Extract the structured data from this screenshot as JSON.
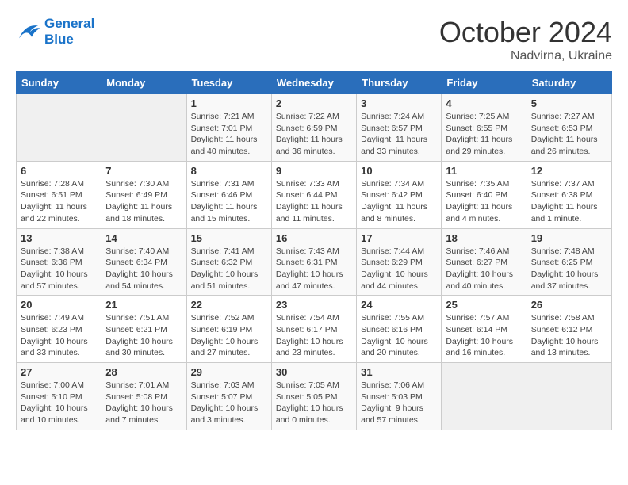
{
  "header": {
    "logo_line1": "General",
    "logo_line2": "Blue",
    "month": "October 2024",
    "location": "Nadvirna, Ukraine"
  },
  "weekdays": [
    "Sunday",
    "Monday",
    "Tuesday",
    "Wednesday",
    "Thursday",
    "Friday",
    "Saturday"
  ],
  "weeks": [
    [
      {
        "day": "",
        "info": ""
      },
      {
        "day": "",
        "info": ""
      },
      {
        "day": "1",
        "info": "Sunrise: 7:21 AM\nSunset: 7:01 PM\nDaylight: 11 hours and 40 minutes."
      },
      {
        "day": "2",
        "info": "Sunrise: 7:22 AM\nSunset: 6:59 PM\nDaylight: 11 hours and 36 minutes."
      },
      {
        "day": "3",
        "info": "Sunrise: 7:24 AM\nSunset: 6:57 PM\nDaylight: 11 hours and 33 minutes."
      },
      {
        "day": "4",
        "info": "Sunrise: 7:25 AM\nSunset: 6:55 PM\nDaylight: 11 hours and 29 minutes."
      },
      {
        "day": "5",
        "info": "Sunrise: 7:27 AM\nSunset: 6:53 PM\nDaylight: 11 hours and 26 minutes."
      }
    ],
    [
      {
        "day": "6",
        "info": "Sunrise: 7:28 AM\nSunset: 6:51 PM\nDaylight: 11 hours and 22 minutes."
      },
      {
        "day": "7",
        "info": "Sunrise: 7:30 AM\nSunset: 6:49 PM\nDaylight: 11 hours and 18 minutes."
      },
      {
        "day": "8",
        "info": "Sunrise: 7:31 AM\nSunset: 6:46 PM\nDaylight: 11 hours and 15 minutes."
      },
      {
        "day": "9",
        "info": "Sunrise: 7:33 AM\nSunset: 6:44 PM\nDaylight: 11 hours and 11 minutes."
      },
      {
        "day": "10",
        "info": "Sunrise: 7:34 AM\nSunset: 6:42 PM\nDaylight: 11 hours and 8 minutes."
      },
      {
        "day": "11",
        "info": "Sunrise: 7:35 AM\nSunset: 6:40 PM\nDaylight: 11 hours and 4 minutes."
      },
      {
        "day": "12",
        "info": "Sunrise: 7:37 AM\nSunset: 6:38 PM\nDaylight: 11 hours and 1 minute."
      }
    ],
    [
      {
        "day": "13",
        "info": "Sunrise: 7:38 AM\nSunset: 6:36 PM\nDaylight: 10 hours and 57 minutes."
      },
      {
        "day": "14",
        "info": "Sunrise: 7:40 AM\nSunset: 6:34 PM\nDaylight: 10 hours and 54 minutes."
      },
      {
        "day": "15",
        "info": "Sunrise: 7:41 AM\nSunset: 6:32 PM\nDaylight: 10 hours and 51 minutes."
      },
      {
        "day": "16",
        "info": "Sunrise: 7:43 AM\nSunset: 6:31 PM\nDaylight: 10 hours and 47 minutes."
      },
      {
        "day": "17",
        "info": "Sunrise: 7:44 AM\nSunset: 6:29 PM\nDaylight: 10 hours and 44 minutes."
      },
      {
        "day": "18",
        "info": "Sunrise: 7:46 AM\nSunset: 6:27 PM\nDaylight: 10 hours and 40 minutes."
      },
      {
        "day": "19",
        "info": "Sunrise: 7:48 AM\nSunset: 6:25 PM\nDaylight: 10 hours and 37 minutes."
      }
    ],
    [
      {
        "day": "20",
        "info": "Sunrise: 7:49 AM\nSunset: 6:23 PM\nDaylight: 10 hours and 33 minutes."
      },
      {
        "day": "21",
        "info": "Sunrise: 7:51 AM\nSunset: 6:21 PM\nDaylight: 10 hours and 30 minutes."
      },
      {
        "day": "22",
        "info": "Sunrise: 7:52 AM\nSunset: 6:19 PM\nDaylight: 10 hours and 27 minutes."
      },
      {
        "day": "23",
        "info": "Sunrise: 7:54 AM\nSunset: 6:17 PM\nDaylight: 10 hours and 23 minutes."
      },
      {
        "day": "24",
        "info": "Sunrise: 7:55 AM\nSunset: 6:16 PM\nDaylight: 10 hours and 20 minutes."
      },
      {
        "day": "25",
        "info": "Sunrise: 7:57 AM\nSunset: 6:14 PM\nDaylight: 10 hours and 16 minutes."
      },
      {
        "day": "26",
        "info": "Sunrise: 7:58 AM\nSunset: 6:12 PM\nDaylight: 10 hours and 13 minutes."
      }
    ],
    [
      {
        "day": "27",
        "info": "Sunrise: 7:00 AM\nSunset: 5:10 PM\nDaylight: 10 hours and 10 minutes."
      },
      {
        "day": "28",
        "info": "Sunrise: 7:01 AM\nSunset: 5:08 PM\nDaylight: 10 hours and 7 minutes."
      },
      {
        "day": "29",
        "info": "Sunrise: 7:03 AM\nSunset: 5:07 PM\nDaylight: 10 hours and 3 minutes."
      },
      {
        "day": "30",
        "info": "Sunrise: 7:05 AM\nSunset: 5:05 PM\nDaylight: 10 hours and 0 minutes."
      },
      {
        "day": "31",
        "info": "Sunrise: 7:06 AM\nSunset: 5:03 PM\nDaylight: 9 hours and 57 minutes."
      },
      {
        "day": "",
        "info": ""
      },
      {
        "day": "",
        "info": ""
      }
    ]
  ]
}
